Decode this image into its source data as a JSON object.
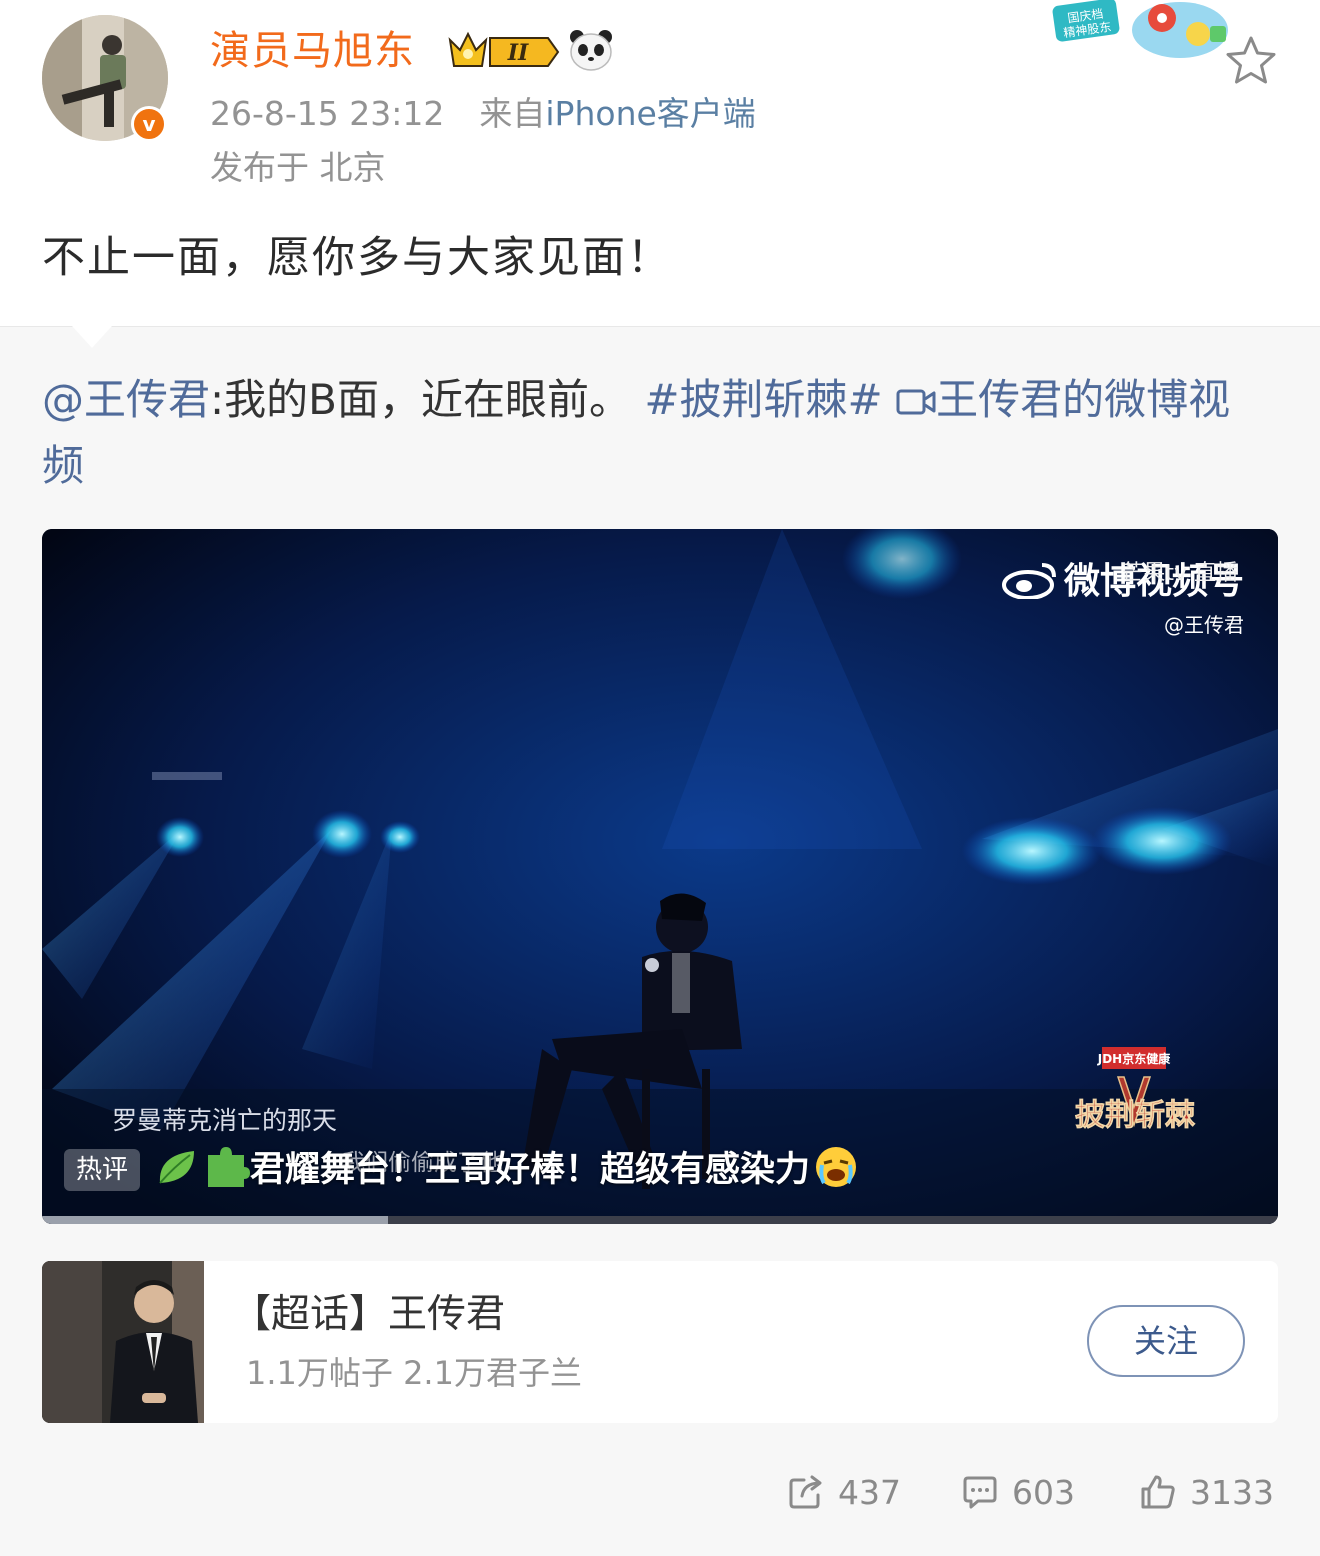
{
  "author": {
    "name": "演员马旭东",
    "level_badge": "II",
    "timestamp": "26-8-15 23:12",
    "source_prefix": "来自",
    "source": "iPhone客户端",
    "location": "发布于 北京",
    "verified_mark": "v"
  },
  "promo_badge": "国庆档 精神股东",
  "post": {
    "content": "不止一面，愿你多与大家见面！"
  },
  "repost": {
    "mention": "@王传君",
    "text": ":我的B面，近在眼前。",
    "hashtag": "#披荆斩棘#",
    "video_link": "王传君的微博视频"
  },
  "video": {
    "watermark_main": "微博视频号",
    "watermark_top": "芒果tv 直播",
    "watermark_user": "@王传君",
    "subtitle": "罗曼蒂克消亡的那天",
    "subtitle2": "我们偷偷成了他",
    "hot_label": "热评",
    "hot_comment": "君耀舞台！王哥好棒！超级有感染力",
    "show_logo": "披荆斩棘",
    "sponsor": "JDH京东健康",
    "progress": 0.28
  },
  "topic": {
    "title": "【超话】王传君",
    "stats": "1.1万帖子 2.1万君子兰",
    "follow_label": "关注"
  },
  "actions": {
    "reposts": "437",
    "comments": "603",
    "likes": "3133"
  }
}
